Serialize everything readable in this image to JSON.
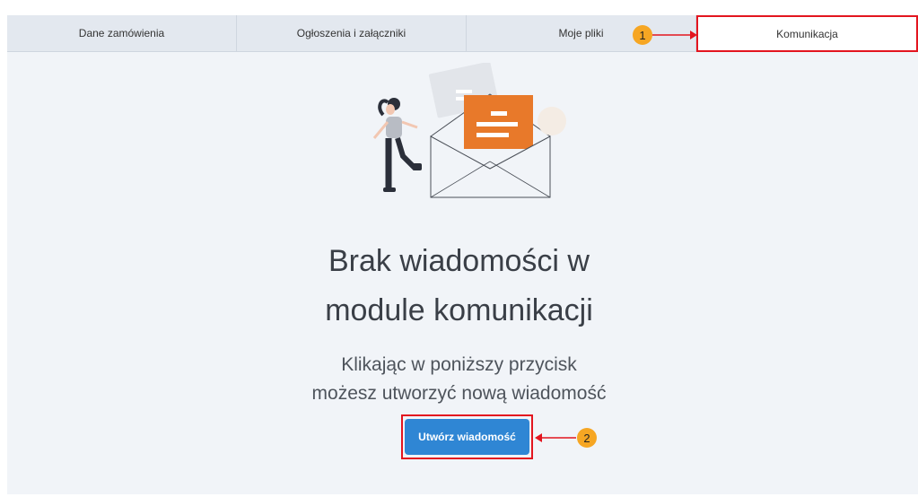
{
  "tabs": [
    {
      "label": "Dane zamówienia"
    },
    {
      "label": "Ogłoszenia i załączniki"
    },
    {
      "label": "Moje pliki"
    },
    {
      "label": "Komunikacja"
    }
  ],
  "empty_state": {
    "title_line1": "Brak wiadomości w",
    "title_line2": "module komunikacji",
    "subtitle_line1": "Klikając w poniższy przycisk",
    "subtitle_line2": "możesz utworzyć nową wiadomość"
  },
  "button": {
    "label": "Utwórz wiadomość"
  },
  "annotations": {
    "step1": "1",
    "step2": "2"
  },
  "colors": {
    "accent": "#2f86d4",
    "highlight": "#e3151f",
    "badge": "#f6a623",
    "envelope_card": "#e8792a"
  },
  "icons": {
    "illustration": "woman-with-envelope-illustration"
  }
}
